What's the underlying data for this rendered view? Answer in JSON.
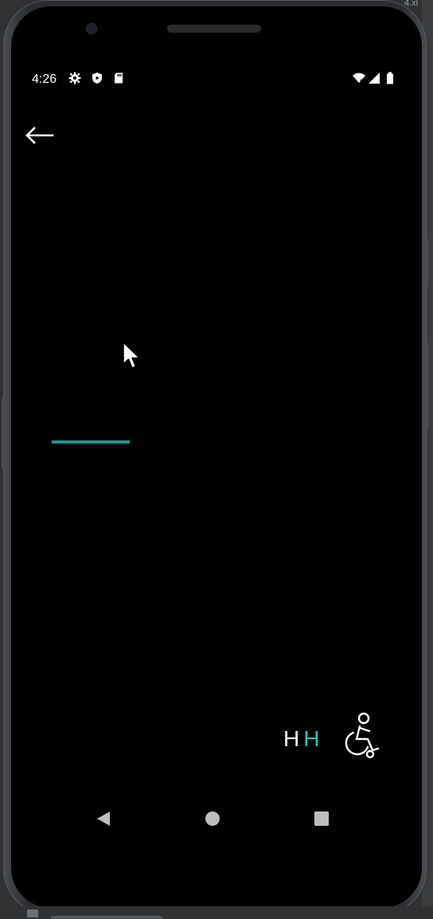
{
  "status_bar": {
    "time": "4:26",
    "left_icons": [
      "gear-icon",
      "shield-icon",
      "sd-card-icon"
    ],
    "right_icons": [
      "wifi-icon",
      "signal-icon",
      "battery-icon"
    ]
  },
  "header": {
    "back_icon": "arrow-left-icon"
  },
  "main": {
    "indicator_color": "#1e958c"
  },
  "footer": {
    "label_part1": "H",
    "label_part2": "H",
    "label_part2_color": "#2bc3b6",
    "accessibility_icon": "wheelchair-icon"
  },
  "nav_bar": {
    "items": [
      "back-triangle-icon",
      "home-circle-icon",
      "recents-square-icon"
    ]
  },
  "desktop": {
    "topright_text": "4.xl"
  }
}
